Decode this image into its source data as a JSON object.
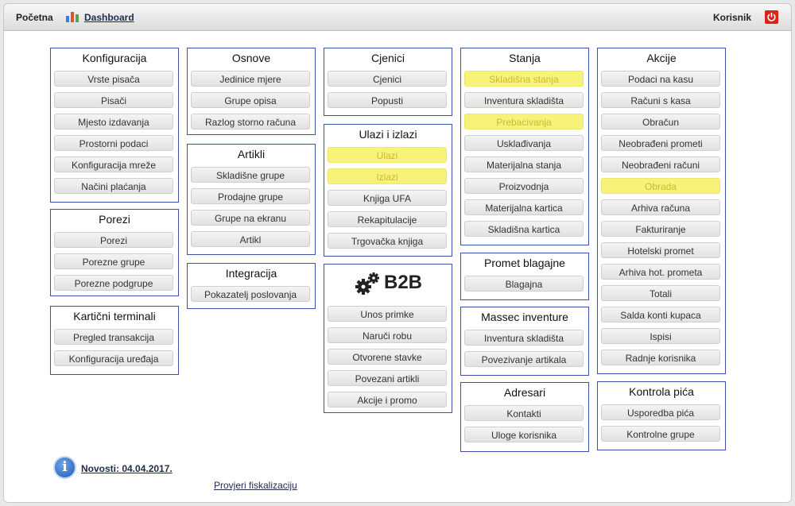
{
  "topbar": {
    "home": "Početna",
    "dashboard": "Dashboard",
    "user": "Korisnik",
    "dashboard_icon": "bar-chart-icon",
    "power_icon": "power-icon"
  },
  "panels": {
    "konfiguracija": {
      "title": "Konfiguracija",
      "items": [
        "Vrste pisača",
        "Pisači",
        "Mjesto izdavanja",
        "Prostorni podaci",
        "Konfiguracija mreže",
        "Načini plaćanja"
      ]
    },
    "porezi": {
      "title": "Porezi",
      "items": [
        "Porezi",
        "Porezne grupe",
        "Porezne podgrupe"
      ]
    },
    "kartice": {
      "title": "Kartični terminali",
      "items": [
        "Pregled transakcija",
        "Konfiguracija uređaja"
      ]
    },
    "osnove": {
      "title": "Osnove",
      "items": [
        "Jedinice mjere",
        "Grupe opisa",
        "Razlog storno računa"
      ]
    },
    "artikli": {
      "title": "Artikli",
      "items": [
        "Skladišne grupe",
        "Prodajne grupe",
        "Grupe na ekranu",
        "Artikl"
      ]
    },
    "integracija": {
      "title": "Integracija",
      "items": [
        "Pokazatelj poslovanja"
      ]
    },
    "cjenici": {
      "title": "Cjenici",
      "items": [
        "Cjenici",
        "Popusti"
      ]
    },
    "ulazi": {
      "title": "Ulazi i izlazi",
      "items": [
        "Ulazi",
        "Izlazi",
        "Knjiga UFA",
        "Rekapitulacije",
        "Trgovačka knjiga"
      ]
    },
    "b2b": {
      "logo": "B2B",
      "icon": "gears-icon",
      "items": [
        "Unos primke",
        "Naruči robu",
        "Otvorene stavke",
        "Povezani artikli",
        "Akcije i promo"
      ]
    },
    "stanja": {
      "title": "Stanja",
      "items": [
        "Skladišna stanja",
        "Inventura skladišta",
        "Prebacivanja",
        "Usklađivanja",
        "Materijalna stanja",
        "Proizvodnja",
        "Materijalna kartica",
        "Skladišna kartica"
      ]
    },
    "promet": {
      "title": "Promet blagajne",
      "items": [
        "Blagajna"
      ]
    },
    "massec": {
      "title": "Massec inventure",
      "items": [
        "Inventura skladišta",
        "Povezivanje artikala"
      ]
    },
    "adresari": {
      "title": "Adresari",
      "items": [
        "Kontakti",
        "Uloge korisnika"
      ]
    },
    "akcije": {
      "title": "Akcije",
      "items": [
        "Podaci na kasu",
        "Računi s kasa",
        "Obračun",
        "Neobrađeni prometi",
        "Neobrađeni računi",
        "Obrada",
        "Arhiva računa",
        "Fakturiranje",
        "Hotelski promet",
        "Arhiva hot. prometa",
        "Totali",
        "Salda konti kupaca",
        "Ispisi",
        "Radnje korisnika"
      ]
    },
    "kontrola": {
      "title": "Kontrola pića",
      "items": [
        "Usporedba pića",
        "Kontrolne grupe"
      ]
    }
  },
  "footer": {
    "novosti": "Novosti: 04.04.2017.",
    "novosti_icon": "info-icon",
    "fiskalizacija": "Provjeri fiskalizaciju"
  },
  "colors": {
    "panel_border": "#3f51a4",
    "highlight": "#f7f27a",
    "power": "#d9231b"
  }
}
